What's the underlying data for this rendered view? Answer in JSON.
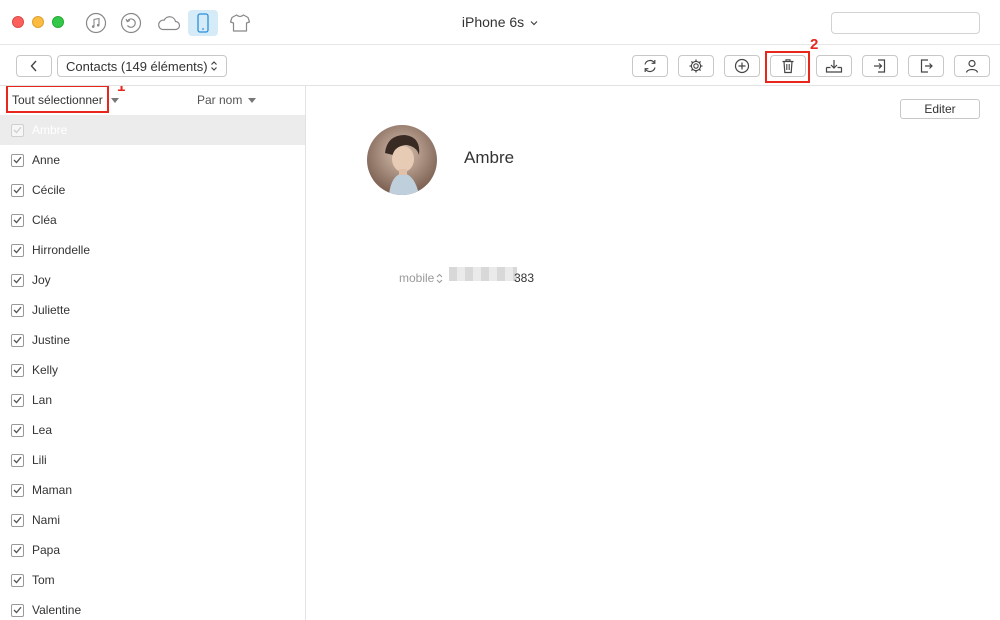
{
  "window": {
    "device_title": "iPhone 6s",
    "search": {
      "placeholder": "",
      "value": ""
    },
    "nav_icons": [
      "music-icon",
      "restore-icon",
      "cloud-icon",
      "phone-icon",
      "shirt-icon"
    ],
    "active_nav": "phone-icon"
  },
  "toolbar": {
    "category_label": "Contacts (149 éléments)",
    "tools": [
      "refresh-icon",
      "settings-icon",
      "add-icon",
      "delete-icon",
      "download-icon",
      "import-icon",
      "export-icon",
      "contact-icon"
    ],
    "annotations": {
      "step1": "1",
      "step2": "2"
    }
  },
  "list": {
    "select_all_label": "Tout sélectionner",
    "sort_label": "Par nom",
    "contacts": [
      {
        "name": "Ambre",
        "checked": true,
        "selected": true
      },
      {
        "name": "Anne",
        "checked": true
      },
      {
        "name": "Cécile",
        "checked": true
      },
      {
        "name": "Cléa",
        "checked": true
      },
      {
        "name": "Hirrondelle",
        "checked": true
      },
      {
        "name": "Joy",
        "checked": true
      },
      {
        "name": "Juliette",
        "checked": true
      },
      {
        "name": "Justine",
        "checked": true
      },
      {
        "name": "Kelly",
        "checked": true
      },
      {
        "name": "Lan",
        "checked": true
      },
      {
        "name": "Lea",
        "checked": true
      },
      {
        "name": "Lili",
        "checked": true
      },
      {
        "name": "Maman",
        "checked": true
      },
      {
        "name": "Nami",
        "checked": true
      },
      {
        "name": "Papa",
        "checked": true
      },
      {
        "name": "Tom",
        "checked": true
      },
      {
        "name": "Valentine",
        "checked": true
      }
    ]
  },
  "detail": {
    "edit_label": "Editer",
    "name": "Ambre",
    "phone_label": "mobile",
    "phone_visible_suffix": "383"
  },
  "colors": {
    "annotation_red": "#e8261c",
    "active_tab_bg": "#d6ebf8",
    "selected_row_bg": "#ececec"
  }
}
